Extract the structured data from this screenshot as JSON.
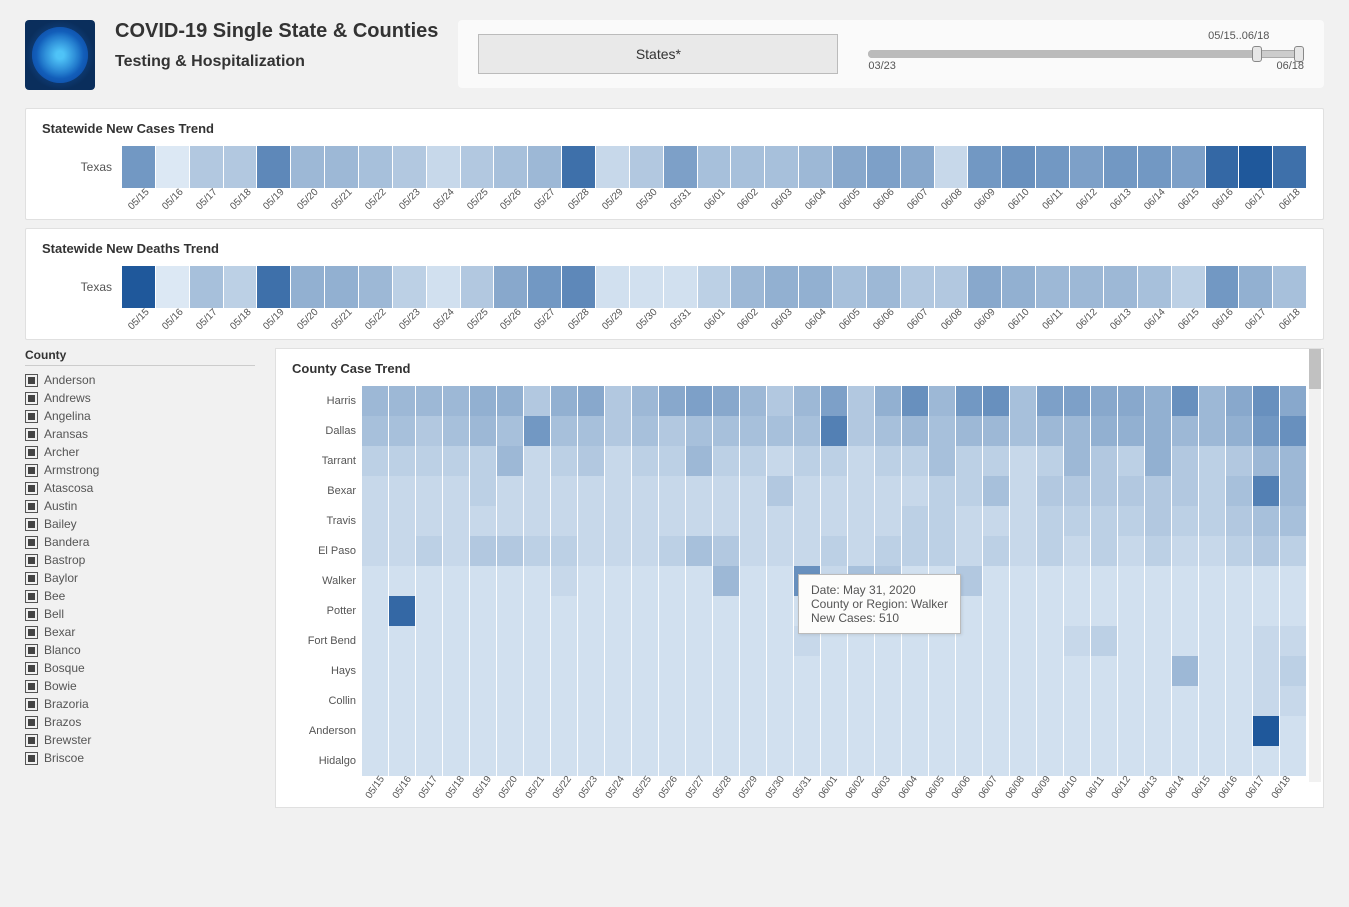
{
  "header": {
    "title": "COVID-19 Single State & Counties",
    "subtitle": "Testing & Hospitalization"
  },
  "controls": {
    "states_button": "States*",
    "slider": {
      "min_label": "03/23",
      "max_label": "06/18",
      "range_label": "05/15..06/18"
    }
  },
  "dates": [
    "05/15",
    "05/16",
    "05/17",
    "05/18",
    "05/19",
    "05/20",
    "05/21",
    "05/22",
    "05/23",
    "05/24",
    "05/25",
    "05/26",
    "05/27",
    "05/28",
    "05/29",
    "05/30",
    "05/31",
    "06/01",
    "06/02",
    "06/03",
    "06/04",
    "06/05",
    "06/06",
    "06/07",
    "06/08",
    "06/09",
    "06/10",
    "06/11",
    "06/12",
    "06/13",
    "06/14",
    "06/15",
    "06/16",
    "06/17",
    "06/18"
  ],
  "panel_cases": {
    "title": "Statewide New Cases Trend",
    "row_label": "Texas"
  },
  "panel_deaths": {
    "title": "Statewide New Deaths Trend",
    "row_label": "Texas"
  },
  "county_filter": {
    "title": "County",
    "items": [
      "Anderson",
      "Andrews",
      "Angelina",
      "Aransas",
      "Archer",
      "Armstrong",
      "Atascosa",
      "Austin",
      "Bailey",
      "Bandera",
      "Bastrop",
      "Baylor",
      "Bee",
      "Bell",
      "Bexar",
      "Blanco",
      "Bosque",
      "Bowie",
      "Brazoria",
      "Brazos",
      "Brewster",
      "Briscoe"
    ]
  },
  "county_panel": {
    "title": "County Case Trend",
    "rows": [
      "Harris",
      "Dallas",
      "Tarrant",
      "Bexar",
      "Travis",
      "El Paso",
      "Walker",
      "Potter",
      "Fort Bend",
      "Hays",
      "Collin",
      "Anderson",
      "Hidalgo"
    ]
  },
  "tooltip": {
    "line1": "Date: May 31, 2020",
    "line2": "County or Region: Walker",
    "line3": "New Cases:  510"
  },
  "chart_data": [
    {
      "type": "heatmap",
      "title": "Statewide New Cases Trend",
      "ylabel": "",
      "xlabel": "",
      "y": [
        "Texas"
      ],
      "x": [
        "05/15",
        "05/16",
        "05/17",
        "05/18",
        "05/19",
        "05/20",
        "05/21",
        "05/22",
        "05/23",
        "05/24",
        "05/25",
        "05/26",
        "05/27",
        "05/28",
        "05/29",
        "05/30",
        "05/31",
        "06/01",
        "06/02",
        "06/03",
        "06/04",
        "06/05",
        "06/06",
        "06/07",
        "06/08",
        "06/09",
        "06/10",
        "06/11",
        "06/12",
        "06/13",
        "06/14",
        "06/15",
        "06/16",
        "06/17",
        "06/18"
      ],
      "z": [
        [
          0.55,
          0.05,
          0.25,
          0.25,
          0.65,
          0.35,
          0.35,
          0.3,
          0.25,
          0.15,
          0.25,
          0.3,
          0.35,
          0.8,
          0.15,
          0.25,
          0.5,
          0.3,
          0.3,
          0.3,
          0.35,
          0.45,
          0.5,
          0.45,
          0.15,
          0.55,
          0.6,
          0.55,
          0.5,
          0.55,
          0.55,
          0.5,
          0.85,
          0.95,
          0.8
        ]
      ]
    },
    {
      "type": "heatmap",
      "title": "Statewide New Deaths Trend",
      "ylabel": "",
      "xlabel": "",
      "y": [
        "Texas"
      ],
      "x": [
        "05/15",
        "05/16",
        "05/17",
        "05/18",
        "05/19",
        "05/20",
        "05/21",
        "05/22",
        "05/23",
        "05/24",
        "05/25",
        "05/26",
        "05/27",
        "05/28",
        "05/29",
        "05/30",
        "05/31",
        "06/01",
        "06/02",
        "06/03",
        "06/04",
        "06/05",
        "06/06",
        "06/07",
        "06/08",
        "06/09",
        "06/10",
        "06/11",
        "06/12",
        "06/13",
        "06/14",
        "06/15",
        "06/16",
        "06/17",
        "06/18"
      ],
      "z": [
        [
          0.95,
          0.05,
          0.3,
          0.2,
          0.8,
          0.4,
          0.4,
          0.35,
          0.2,
          0.1,
          0.25,
          0.45,
          0.55,
          0.65,
          0.1,
          0.1,
          0.1,
          0.2,
          0.35,
          0.4,
          0.4,
          0.3,
          0.35,
          0.25,
          0.25,
          0.45,
          0.4,
          0.35,
          0.35,
          0.35,
          0.3,
          0.2,
          0.55,
          0.4,
          0.3
        ]
      ]
    },
    {
      "type": "heatmap",
      "title": "County Case Trend",
      "ylabel": "",
      "xlabel": "",
      "y": [
        "Harris",
        "Dallas",
        "Tarrant",
        "Bexar",
        "Travis",
        "El Paso",
        "Walker",
        "Potter",
        "Fort Bend",
        "Hays",
        "Collin",
        "Anderson",
        "Hidalgo"
      ],
      "x": [
        "05/15",
        "05/16",
        "05/17",
        "05/18",
        "05/19",
        "05/20",
        "05/21",
        "05/22",
        "05/23",
        "05/24",
        "05/25",
        "05/26",
        "05/27",
        "05/28",
        "05/29",
        "05/30",
        "05/31",
        "06/01",
        "06/02",
        "06/03",
        "06/04",
        "06/05",
        "06/06",
        "06/07",
        "06/08",
        "06/09",
        "06/10",
        "06/11",
        "06/12",
        "06/13",
        "06/14",
        "06/15",
        "06/16",
        "06/17",
        "06/18"
      ],
      "z": [
        [
          0.35,
          0.35,
          0.35,
          0.35,
          0.4,
          0.4,
          0.25,
          0.4,
          0.45,
          0.25,
          0.35,
          0.45,
          0.5,
          0.45,
          0.35,
          0.25,
          0.35,
          0.5,
          0.25,
          0.4,
          0.6,
          0.35,
          0.55,
          0.6,
          0.3,
          0.5,
          0.5,
          0.45,
          0.45,
          0.4,
          0.6,
          0.35,
          0.45,
          0.6,
          0.45
        ],
        [
          0.3,
          0.3,
          0.25,
          0.3,
          0.35,
          0.3,
          0.55,
          0.3,
          0.3,
          0.25,
          0.3,
          0.25,
          0.3,
          0.3,
          0.3,
          0.3,
          0.3,
          0.7,
          0.25,
          0.3,
          0.35,
          0.3,
          0.35,
          0.35,
          0.3,
          0.35,
          0.35,
          0.4,
          0.4,
          0.4,
          0.35,
          0.35,
          0.4,
          0.55,
          0.6
        ],
        [
          0.2,
          0.2,
          0.2,
          0.2,
          0.2,
          0.35,
          0.15,
          0.2,
          0.25,
          0.15,
          0.2,
          0.2,
          0.35,
          0.2,
          0.2,
          0.15,
          0.2,
          0.2,
          0.15,
          0.2,
          0.2,
          0.3,
          0.2,
          0.2,
          0.15,
          0.2,
          0.35,
          0.25,
          0.2,
          0.4,
          0.25,
          0.2,
          0.25,
          0.35,
          0.35
        ],
        [
          0.15,
          0.15,
          0.15,
          0.15,
          0.2,
          0.15,
          0.15,
          0.15,
          0.15,
          0.15,
          0.15,
          0.15,
          0.15,
          0.15,
          0.15,
          0.25,
          0.15,
          0.15,
          0.15,
          0.15,
          0.15,
          0.2,
          0.2,
          0.3,
          0.15,
          0.25,
          0.25,
          0.25,
          0.25,
          0.25,
          0.25,
          0.2,
          0.3,
          0.7,
          0.35
        ],
        [
          0.15,
          0.15,
          0.15,
          0.15,
          0.15,
          0.15,
          0.15,
          0.15,
          0.15,
          0.15,
          0.15,
          0.15,
          0.15,
          0.15,
          0.15,
          0.15,
          0.15,
          0.15,
          0.15,
          0.15,
          0.2,
          0.2,
          0.15,
          0.15,
          0.15,
          0.2,
          0.2,
          0.2,
          0.2,
          0.25,
          0.2,
          0.2,
          0.25,
          0.3,
          0.3
        ],
        [
          0.15,
          0.15,
          0.2,
          0.15,
          0.25,
          0.25,
          0.2,
          0.2,
          0.15,
          0.15,
          0.15,
          0.2,
          0.3,
          0.25,
          0.15,
          0.15,
          0.15,
          0.2,
          0.15,
          0.2,
          0.2,
          0.2,
          0.15,
          0.2,
          0.15,
          0.2,
          0.15,
          0.2,
          0.15,
          0.2,
          0.15,
          0.15,
          0.2,
          0.25,
          0.2
        ],
        [
          0.1,
          0.1,
          0.1,
          0.1,
          0.1,
          0.1,
          0.1,
          0.15,
          0.1,
          0.1,
          0.1,
          0.1,
          0.1,
          0.35,
          0.1,
          0.1,
          0.6,
          0.15,
          0.3,
          0.25,
          0.1,
          0.1,
          0.25,
          0.1,
          0.1,
          0.1,
          0.1,
          0.1,
          0.1,
          0.1,
          0.1,
          0.1,
          0.1,
          0.1,
          0.1
        ],
        [
          0.1,
          0.85,
          0.1,
          0.1,
          0.1,
          0.1,
          0.1,
          0.1,
          0.1,
          0.1,
          0.1,
          0.1,
          0.1,
          0.1,
          0.1,
          0.1,
          0.1,
          0.1,
          0.1,
          0.1,
          0.1,
          0.1,
          0.1,
          0.1,
          0.1,
          0.1,
          0.1,
          0.1,
          0.1,
          0.1,
          0.1,
          0.1,
          0.1,
          0.1,
          0.1
        ],
        [
          0.1,
          0.1,
          0.1,
          0.1,
          0.1,
          0.1,
          0.1,
          0.1,
          0.1,
          0.1,
          0.1,
          0.1,
          0.1,
          0.1,
          0.1,
          0.1,
          0.15,
          0.1,
          0.1,
          0.1,
          0.1,
          0.1,
          0.1,
          0.1,
          0.1,
          0.1,
          0.15,
          0.2,
          0.1,
          0.1,
          0.1,
          0.1,
          0.1,
          0.15,
          0.15
        ],
        [
          0.1,
          0.1,
          0.1,
          0.1,
          0.1,
          0.1,
          0.1,
          0.1,
          0.1,
          0.1,
          0.1,
          0.1,
          0.1,
          0.1,
          0.1,
          0.1,
          0.1,
          0.1,
          0.1,
          0.1,
          0.1,
          0.1,
          0.1,
          0.1,
          0.1,
          0.1,
          0.1,
          0.1,
          0.1,
          0.1,
          0.35,
          0.1,
          0.1,
          0.15,
          0.2
        ],
        [
          0.1,
          0.1,
          0.1,
          0.1,
          0.1,
          0.1,
          0.1,
          0.1,
          0.1,
          0.1,
          0.1,
          0.1,
          0.1,
          0.1,
          0.1,
          0.1,
          0.1,
          0.1,
          0.1,
          0.1,
          0.1,
          0.1,
          0.1,
          0.1,
          0.1,
          0.1,
          0.1,
          0.1,
          0.1,
          0.1,
          0.1,
          0.1,
          0.1,
          0.15,
          0.15
        ],
        [
          0.1,
          0.1,
          0.1,
          0.1,
          0.1,
          0.1,
          0.1,
          0.1,
          0.1,
          0.1,
          0.1,
          0.1,
          0.1,
          0.1,
          0.1,
          0.1,
          0.1,
          0.1,
          0.1,
          0.1,
          0.1,
          0.1,
          0.1,
          0.1,
          0.1,
          0.1,
          0.1,
          0.1,
          0.1,
          0.1,
          0.1,
          0.1,
          0.1,
          0.95,
          0.1
        ],
        [
          0.1,
          0.1,
          0.1,
          0.1,
          0.1,
          0.1,
          0.1,
          0.1,
          0.1,
          0.1,
          0.1,
          0.1,
          0.1,
          0.1,
          0.1,
          0.1,
          0.1,
          0.1,
          0.1,
          0.1,
          0.1,
          0.1,
          0.1,
          0.1,
          0.1,
          0.1,
          0.1,
          0.1,
          0.1,
          0.1,
          0.1,
          0.1,
          0.1,
          0.1,
          0.1
        ]
      ],
      "tooltip_sample": {
        "date": "May 31, 2020",
        "region": "Walker",
        "new_cases": 510
      }
    }
  ]
}
